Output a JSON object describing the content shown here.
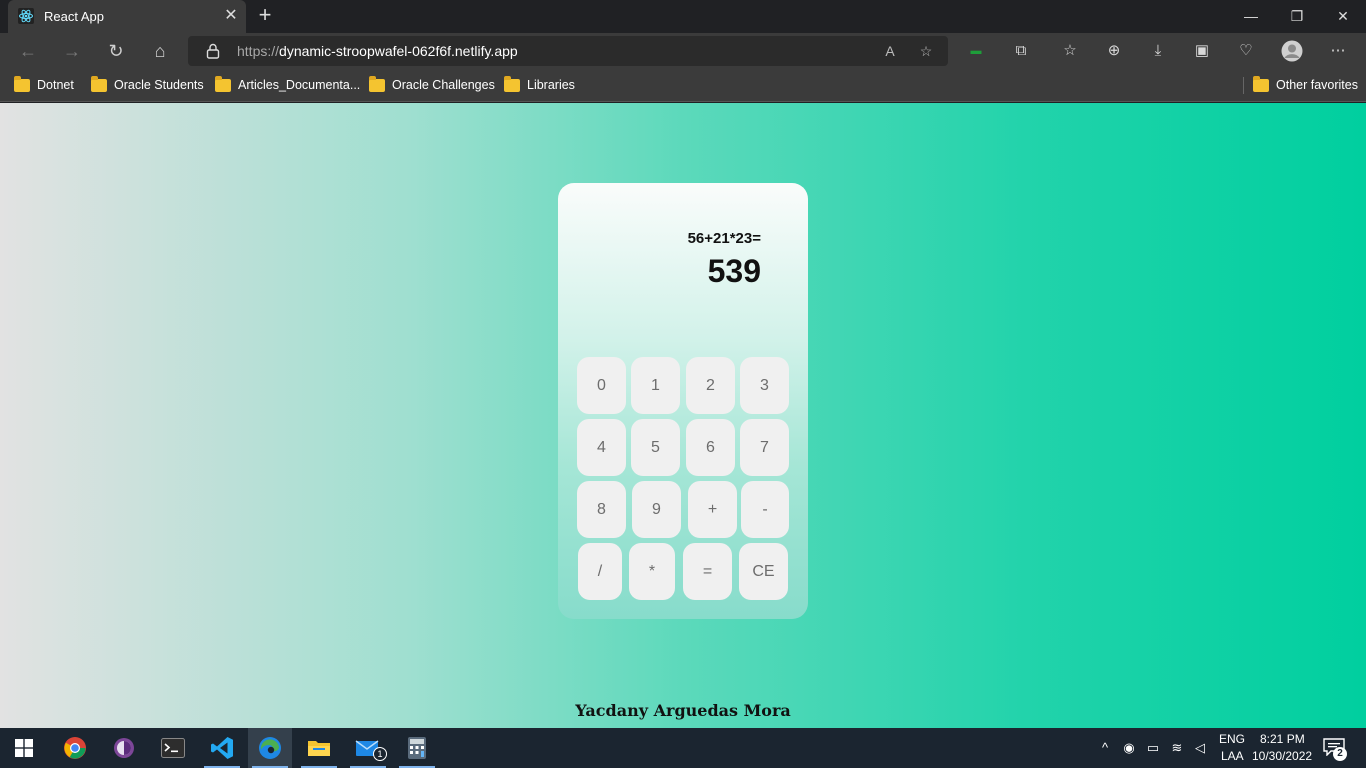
{
  "browser": {
    "tab_title": "React App",
    "tab_close": "✕",
    "new_tab": "+",
    "url_scheme": "https://",
    "url_host": "dynamic-stroopwafel-062f6f.netlify.app",
    "window_controls": [
      "—",
      "❐",
      "✕"
    ],
    "bookmarks": [
      "Dotnet",
      "Oracle Students",
      "Articles_Documenta...",
      "Oracle Challenges",
      "Libraries"
    ],
    "other_favorites": "Other favorites"
  },
  "calculator": {
    "expression": "56+21*23=",
    "result": "539",
    "keys": [
      [
        "0",
        "1",
        "2",
        "3"
      ],
      [
        "4",
        "5",
        "6",
        "7"
      ],
      [
        "8",
        "9",
        "+",
        "-"
      ],
      [
        "/",
        "*",
        "=",
        "CE"
      ]
    ]
  },
  "footer": {
    "author": "Yacdany Arguedas Mora"
  },
  "taskbar": {
    "language": "ENG",
    "layout": "LAA",
    "time": "8:21 PM",
    "date": "10/30/2022",
    "mail_badge": "1",
    "notification_count": "2"
  },
  "colors": {
    "accent": "#00cf9f",
    "key_bg": "#f0f0f0",
    "key_text": "#6d6d6d"
  }
}
